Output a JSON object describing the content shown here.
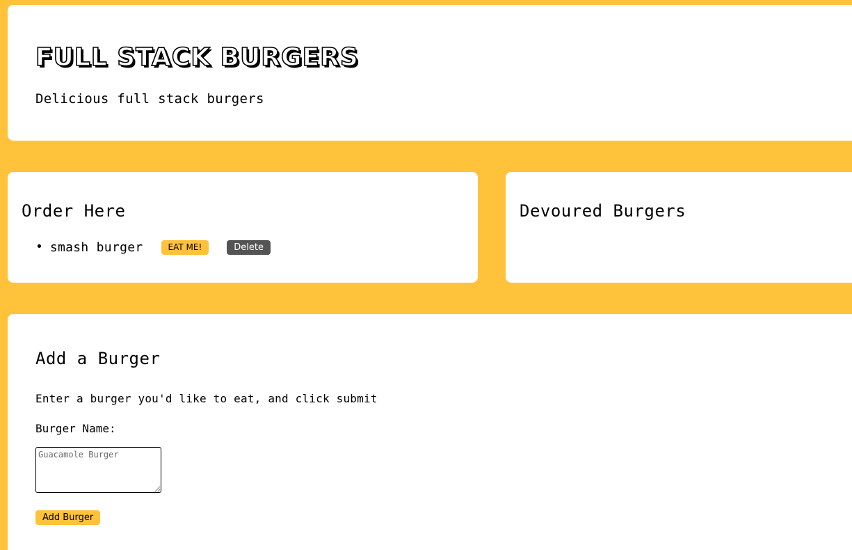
{
  "header": {
    "title": "FULL STACK BURGERS",
    "subtitle": "Delicious full stack burgers"
  },
  "order": {
    "title": "Order Here",
    "bullet": "•",
    "items": [
      {
        "name": "smash burger",
        "eat_label": "EAT ME!",
        "delete_label": "Delete"
      }
    ]
  },
  "devoured": {
    "title": "Devoured Burgers",
    "items": []
  },
  "add": {
    "title": "Add a Burger",
    "description": "Enter a burger you'd like to eat, and click submit",
    "field_label": "Burger Name:",
    "placeholder": "Guacamole Burger",
    "value": "",
    "submit_label": "Add Burger"
  },
  "colors": {
    "background": "#ffc23a",
    "card": "#ffffff",
    "accent": "#ffc23a",
    "delete_button": "#545454"
  }
}
